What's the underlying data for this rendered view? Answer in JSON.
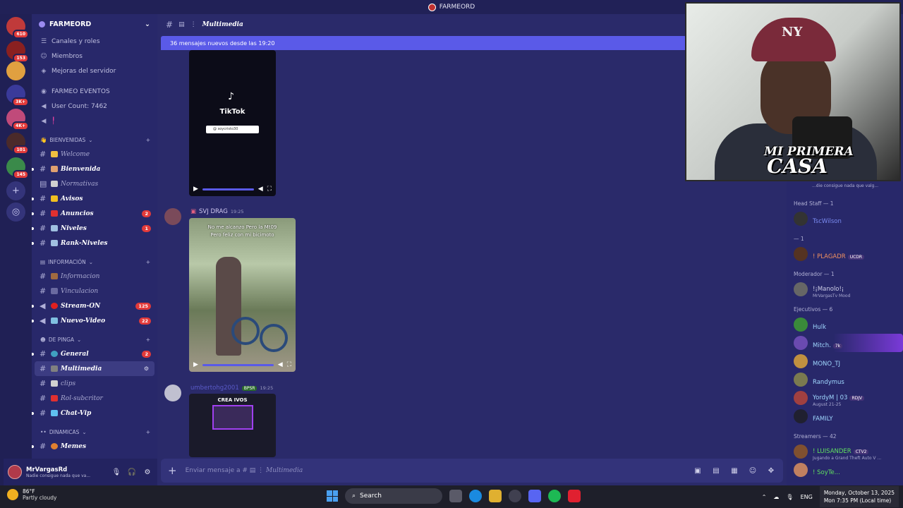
{
  "window": {
    "title": "FARMEORD"
  },
  "servers": [
    {
      "badge": "610"
    },
    {
      "badge": "153"
    },
    {
      "badge": ""
    },
    {
      "badge": "3K+"
    },
    {
      "badge": "4K+"
    },
    {
      "badge": "101"
    },
    {
      "badge": "145"
    }
  ],
  "sidebar": {
    "server_name": "FARMEORD",
    "top": [
      {
        "label": "Canales y roles"
      },
      {
        "label": "Miembros"
      },
      {
        "label": "Mejoras del servidor"
      }
    ],
    "info": [
      {
        "label": "FARMEO EVENTOS"
      },
      {
        "label": "User Count: 7462"
      },
      {
        "label": ""
      }
    ],
    "categories": [
      {
        "name": "BIENVENIDAS",
        "channels": [
          {
            "name": "Welcome",
            "bold": false,
            "badge": ""
          },
          {
            "name": "Bienvenida",
            "bold": true,
            "badge": ""
          },
          {
            "name": "Normativas",
            "bold": false,
            "badge": ""
          },
          {
            "name": "Avisos",
            "bold": true,
            "badge": ""
          },
          {
            "name": "Anuncios",
            "bold": true,
            "badge": "2"
          },
          {
            "name": "Niveles",
            "bold": true,
            "badge": "1"
          },
          {
            "name": "Rank-Niveles",
            "bold": true,
            "badge": ""
          }
        ]
      },
      {
        "name": "INFORMACIÓN",
        "channels": [
          {
            "name": "Informacion",
            "bold": false,
            "badge": ""
          },
          {
            "name": "Vinculacion",
            "bold": false,
            "badge": ""
          },
          {
            "name": "Stream-ON",
            "bold": true,
            "badge": "125"
          },
          {
            "name": "Nuevo-Video",
            "bold": true,
            "badge": "22"
          }
        ]
      },
      {
        "name": "DE PINGA",
        "channels": [
          {
            "name": "General",
            "bold": true,
            "badge": "2"
          },
          {
            "name": "Multimedia",
            "bold": true,
            "badge": ""
          },
          {
            "name": "clips",
            "bold": false,
            "badge": ""
          },
          {
            "name": "Rol-subcritor",
            "bold": false,
            "badge": ""
          },
          {
            "name": "Chat-Vip",
            "bold": true,
            "badge": ""
          }
        ]
      },
      {
        "name": "DINAMICAS",
        "channels": [
          {
            "name": "Memes",
            "bold": true,
            "badge": ""
          }
        ]
      }
    ]
  },
  "user": {
    "name": "MrVargasRd",
    "status": "Nadie consigue nada que va..."
  },
  "chat": {
    "channel": "Multimedia",
    "new_messages": "36 mensajes nuevos desde las 19:20",
    "tiktok_label": "TikTok",
    "tiktok_handle": "@ soycristo30",
    "msg1": {
      "author": "SVJ DRAG",
      "time": "19:25",
      "caption1": "No me alcanzo Pero la Mt09",
      "caption2": "Pero feliz con mi bicimoto"
    },
    "msg2": {
      "author": "umbertohg2001",
      "tag": "BPSR",
      "time": "19:25",
      "thumb": "CREA IVOS"
    },
    "input_prefix": "Enviar mensaje a #",
    "input_channel": "Multimedia"
  },
  "overlay": {
    "cap_logo": "NY",
    "line1": "MI PRIMERA",
    "line2": "CASA",
    "preview": "...die consigue nada que valg..."
  },
  "members": [
    {
      "section": "Head Staff — 1",
      "items": [
        {
          "name": "TscWilson",
          "color": "#7a8af0",
          "sub": "",
          "tag": ""
        }
      ]
    },
    {
      "section": "— 1",
      "items": [
        {
          "name": "! PLAGADR",
          "color": "#f09060",
          "sub": "",
          "tag": "UCDR"
        }
      ]
    },
    {
      "section": "Moderador — 1",
      "items": [
        {
          "name": "!¡Manolo!¡",
          "color": "#d0d0e8",
          "sub": "MrVargasTv Mood",
          "tag": ""
        }
      ]
    },
    {
      "section": "Ejecutivos — 6",
      "items": [
        {
          "name": "Hulk",
          "color": "#a0d8ff",
          "sub": "",
          "tag": ""
        },
        {
          "name": "Mitch.",
          "color": "#a0d8ff",
          "sub": "",
          "tag": "7k"
        },
        {
          "name": "MONO_TJ",
          "color": "#a0d8ff",
          "sub": "",
          "tag": ""
        },
        {
          "name": "Randymus",
          "color": "#a0d8ff",
          "sub": "",
          "tag": ""
        },
        {
          "name": "YordyM | 03",
          "color": "#a0d8ff",
          "sub": "August 21-25",
          "tag": "RDJV"
        },
        {
          "name": "FAMILY",
          "color": "#a0d8ff",
          "sub": "",
          "tag": ""
        }
      ]
    },
    {
      "section": "Streamers — 42",
      "items": [
        {
          "name": "! LUISANDER",
          "color": "#60e060",
          "sub": "Jugando a Grand Theft Auto V ...",
          "tag": "CTV2"
        },
        {
          "name": "! SoyTe...",
          "color": "#60e060",
          "sub": "",
          "tag": ""
        }
      ]
    }
  ],
  "taskbar": {
    "temp": "86°F",
    "weather": "Partly cloudy",
    "search": "Search",
    "lang": "ENG",
    "date": "Monday, October 13, 2025",
    "time": "Mon 7:35 PM (Local time)"
  }
}
